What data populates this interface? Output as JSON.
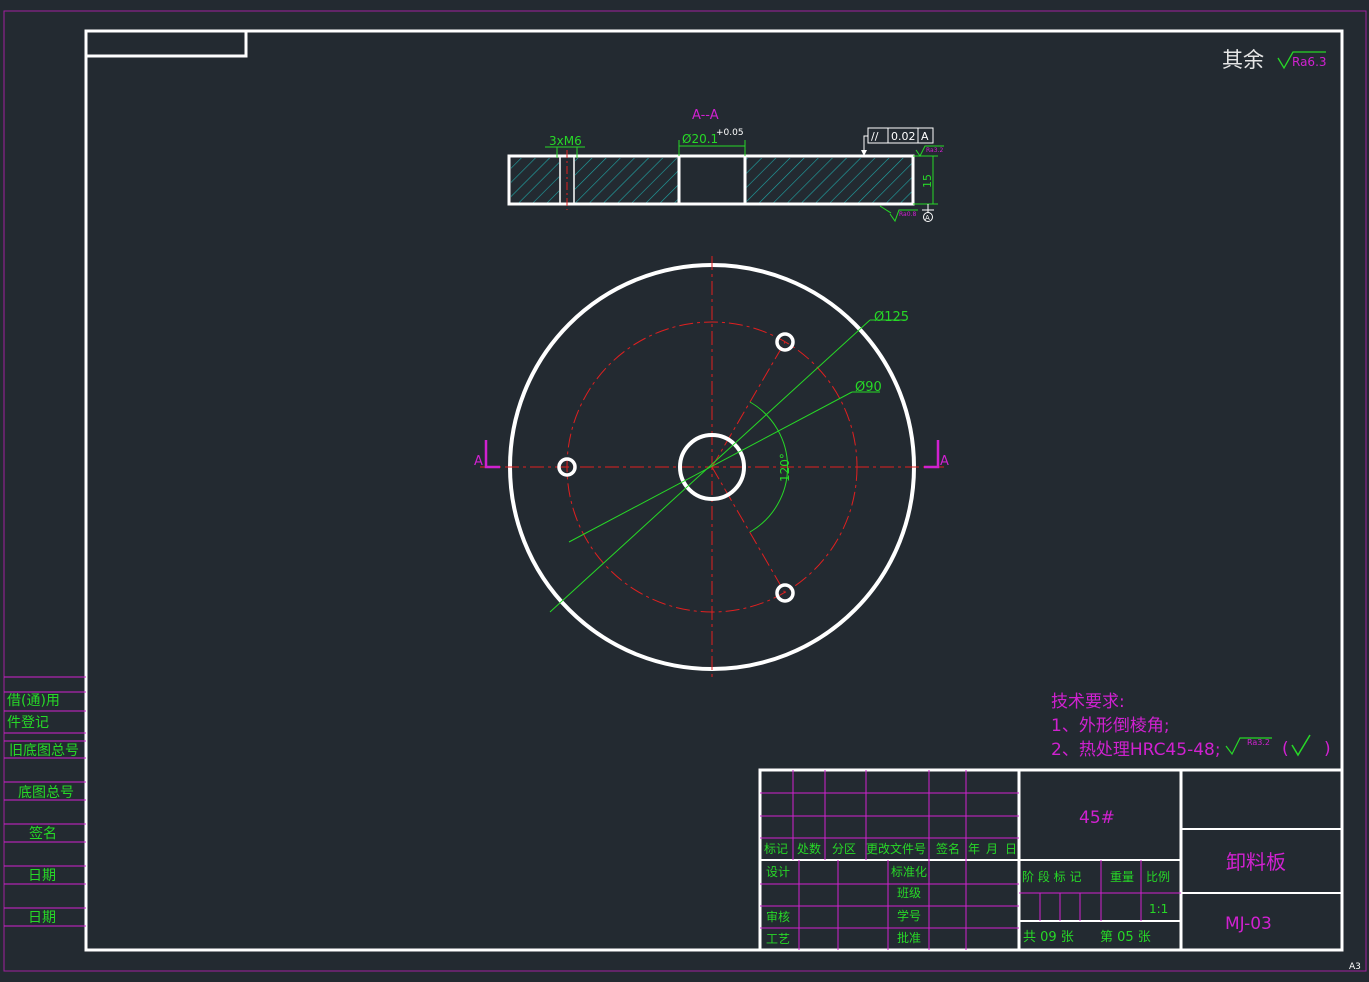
{
  "drawing": {
    "sheet_size": "A3",
    "roughness_note": {
      "label": "其余",
      "value": "Ra6.3"
    },
    "section": {
      "title": "A--A",
      "thread_callout": "3xM6",
      "bore_callout": "Ø20.1",
      "bore_tolerance": "+0.05",
      "tolerance_frame": {
        "symbol": "//",
        "value": "0.02",
        "datum": "A"
      },
      "top_roughness": "Ra3.2",
      "bottom_roughness": "Ra0.8",
      "thickness": "15",
      "datum_label": "A"
    },
    "plan": {
      "outer_dia": "Ø125",
      "pitch_dia": "Ø90",
      "angle": "120°",
      "cut_left": "A",
      "cut_right": "A"
    },
    "tech_requirements": {
      "title": "技术要求:",
      "items": [
        "1、外形倒棱角;",
        "2、热处理HRC45-48;"
      ],
      "roughness": "Ra3.2",
      "bracket_open": "(",
      "bracket_close": ")"
    },
    "left_strip": [
      "借(通)用",
      "件登记",
      "旧底图总号",
      "底图总号",
      "签名",
      "日期",
      "日期"
    ],
    "title_block": {
      "material": "45#",
      "part_name": "卸料板",
      "drawing_no": "MJ-03",
      "revision_headers": [
        "标记",
        "处数",
        "分区",
        "更改文件号",
        "签名",
        "年",
        "月",
        "日"
      ],
      "left_labels": [
        "设计",
        "审核",
        "工艺"
      ],
      "mid_labels": [
        "标准化",
        "班级",
        "学号",
        "批准"
      ],
      "stage_header": "阶 段 标 记",
      "weight_header": "重量",
      "scale_header": "比例",
      "scale_value": "1:1",
      "sheets_total": "共 09 张",
      "sheet_no": "第 05 张"
    }
  },
  "colors": {
    "background": "#232a31",
    "outline": "#ffffff",
    "dimension": "#27d827",
    "centerline": "#e02020",
    "annotation": "#d021d0",
    "hatch": "#1fa6a6"
  }
}
